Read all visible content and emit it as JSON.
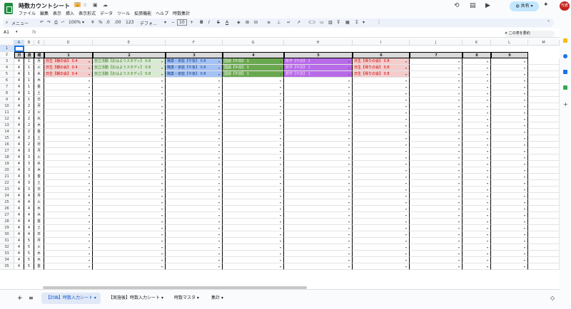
{
  "app": {
    "title": "時数カウントシート",
    "badge": "🔒",
    "menu": [
      "ファイル",
      "編集",
      "表示",
      "挿入",
      "表示形式",
      "データ",
      "ツール",
      "拡張機能",
      "ヘルプ",
      "時数集計"
    ],
    "share_label": "共有",
    "avatar_text": "代表"
  },
  "toolbar": {
    "search_label": "メニュー",
    "zoom": "100%",
    "currency": "¥",
    "percent": "%",
    "decimal_dec": ".0",
    "decimal_inc": ".00",
    "number_format": "123",
    "font": "デフォ...",
    "font_size": "10"
  },
  "formula_bar": {
    "cell_ref": "A1",
    "fx": "fx",
    "summary_button": "この表を要約"
  },
  "columns": [
    "A",
    "B",
    "C",
    "D",
    "E",
    "F",
    "G",
    "H",
    "I",
    "J",
    "K",
    "L",
    "M"
  ],
  "header_row": {
    "month": "月",
    "week": "週",
    "day": "曜",
    "slots": [
      "1",
      "2",
      "3",
      "4",
      "5",
      "6",
      "7",
      "8",
      "9"
    ]
  },
  "filled_entries": {
    "slot1": "日生【朝の会】 0.4",
    "slot2": "自立活動【おはようスタディ】 0.8",
    "slot3": "職業・家庭【午後】 0.8",
    "slot4": "国語【午前】 1",
    "slot5": "数学【午前】 1",
    "slot6": "日生【帰りの会】 0.8"
  },
  "rows": [
    {
      "n": "3",
      "m": "4",
      "w": "1",
      "d": "月"
    },
    {
      "n": "4",
      "m": "4",
      "w": "1",
      "d": "火"
    },
    {
      "n": "5",
      "m": "4",
      "w": "1",
      "d": "水"
    },
    {
      "n": "6",
      "m": "4",
      "w": "1",
      "d": "木"
    },
    {
      "n": "7",
      "m": "4",
      "w": "1",
      "d": "金"
    },
    {
      "n": "8",
      "m": "4",
      "w": "1",
      "d": "土"
    },
    {
      "n": "9",
      "m": "4",
      "w": "1",
      "d": "日"
    },
    {
      "n": "10",
      "m": "4",
      "w": "2",
      "d": "月"
    },
    {
      "n": "11",
      "m": "4",
      "w": "2",
      "d": "火"
    },
    {
      "n": "12",
      "m": "4",
      "w": "2",
      "d": "水"
    },
    {
      "n": "13",
      "m": "4",
      "w": "2",
      "d": "木"
    },
    {
      "n": "14",
      "m": "4",
      "w": "2",
      "d": "金"
    },
    {
      "n": "15",
      "m": "4",
      "w": "2",
      "d": "土"
    },
    {
      "n": "16",
      "m": "4",
      "w": "2",
      "d": "日"
    },
    {
      "n": "17",
      "m": "4",
      "w": "3",
      "d": "月"
    },
    {
      "n": "18",
      "m": "4",
      "w": "3",
      "d": "火"
    },
    {
      "n": "19",
      "m": "4",
      "w": "3",
      "d": "水"
    },
    {
      "n": "20",
      "m": "4",
      "w": "3",
      "d": "木"
    },
    {
      "n": "21",
      "m": "4",
      "w": "3",
      "d": "金"
    },
    {
      "n": "22",
      "m": "4",
      "w": "3",
      "d": "土"
    },
    {
      "n": "23",
      "m": "4",
      "w": "3",
      "d": "日"
    },
    {
      "n": "24",
      "m": "4",
      "w": "4",
      "d": "月"
    },
    {
      "n": "25",
      "m": "4",
      "w": "4",
      "d": "火"
    },
    {
      "n": "26",
      "m": "4",
      "w": "4",
      "d": "水"
    },
    {
      "n": "27",
      "m": "4",
      "w": "4",
      "d": "木"
    },
    {
      "n": "28",
      "m": "4",
      "w": "4",
      "d": "金"
    },
    {
      "n": "29",
      "m": "4",
      "w": "4",
      "d": "土"
    },
    {
      "n": "30",
      "m": "4",
      "w": "4",
      "d": "日"
    },
    {
      "n": "31",
      "m": "4",
      "w": "5",
      "d": "月"
    },
    {
      "n": "32",
      "m": "4",
      "w": "5",
      "d": "火"
    },
    {
      "n": "33",
      "m": "4",
      "w": "5",
      "d": "水"
    },
    {
      "n": "34",
      "m": "4",
      "w": "5",
      "d": "木"
    },
    {
      "n": "35",
      "m": "4",
      "w": "5",
      "d": "金"
    }
  ],
  "sheet_tabs": [
    "【計画】時数入力シート",
    "【実施後】時数入力シート",
    "時数マスタ",
    "集計"
  ],
  "colors": {
    "slot1_bg": "#f4cccc",
    "slot1_fg": "#cc0000",
    "slot2_bg": "#d9ead3",
    "slot2_fg": "#38761d",
    "slot3_bg": "#a4c2f4",
    "slot3_fg": "#1c4587",
    "slot4_bg": "#6aa84f",
    "slot4_fg": "#ffffff",
    "slot5_bg": "#b76be8",
    "slot5_fg": "#f3d1ff",
    "slot6_bg": "#f4cccc",
    "slot6_fg": "#cc0000"
  }
}
